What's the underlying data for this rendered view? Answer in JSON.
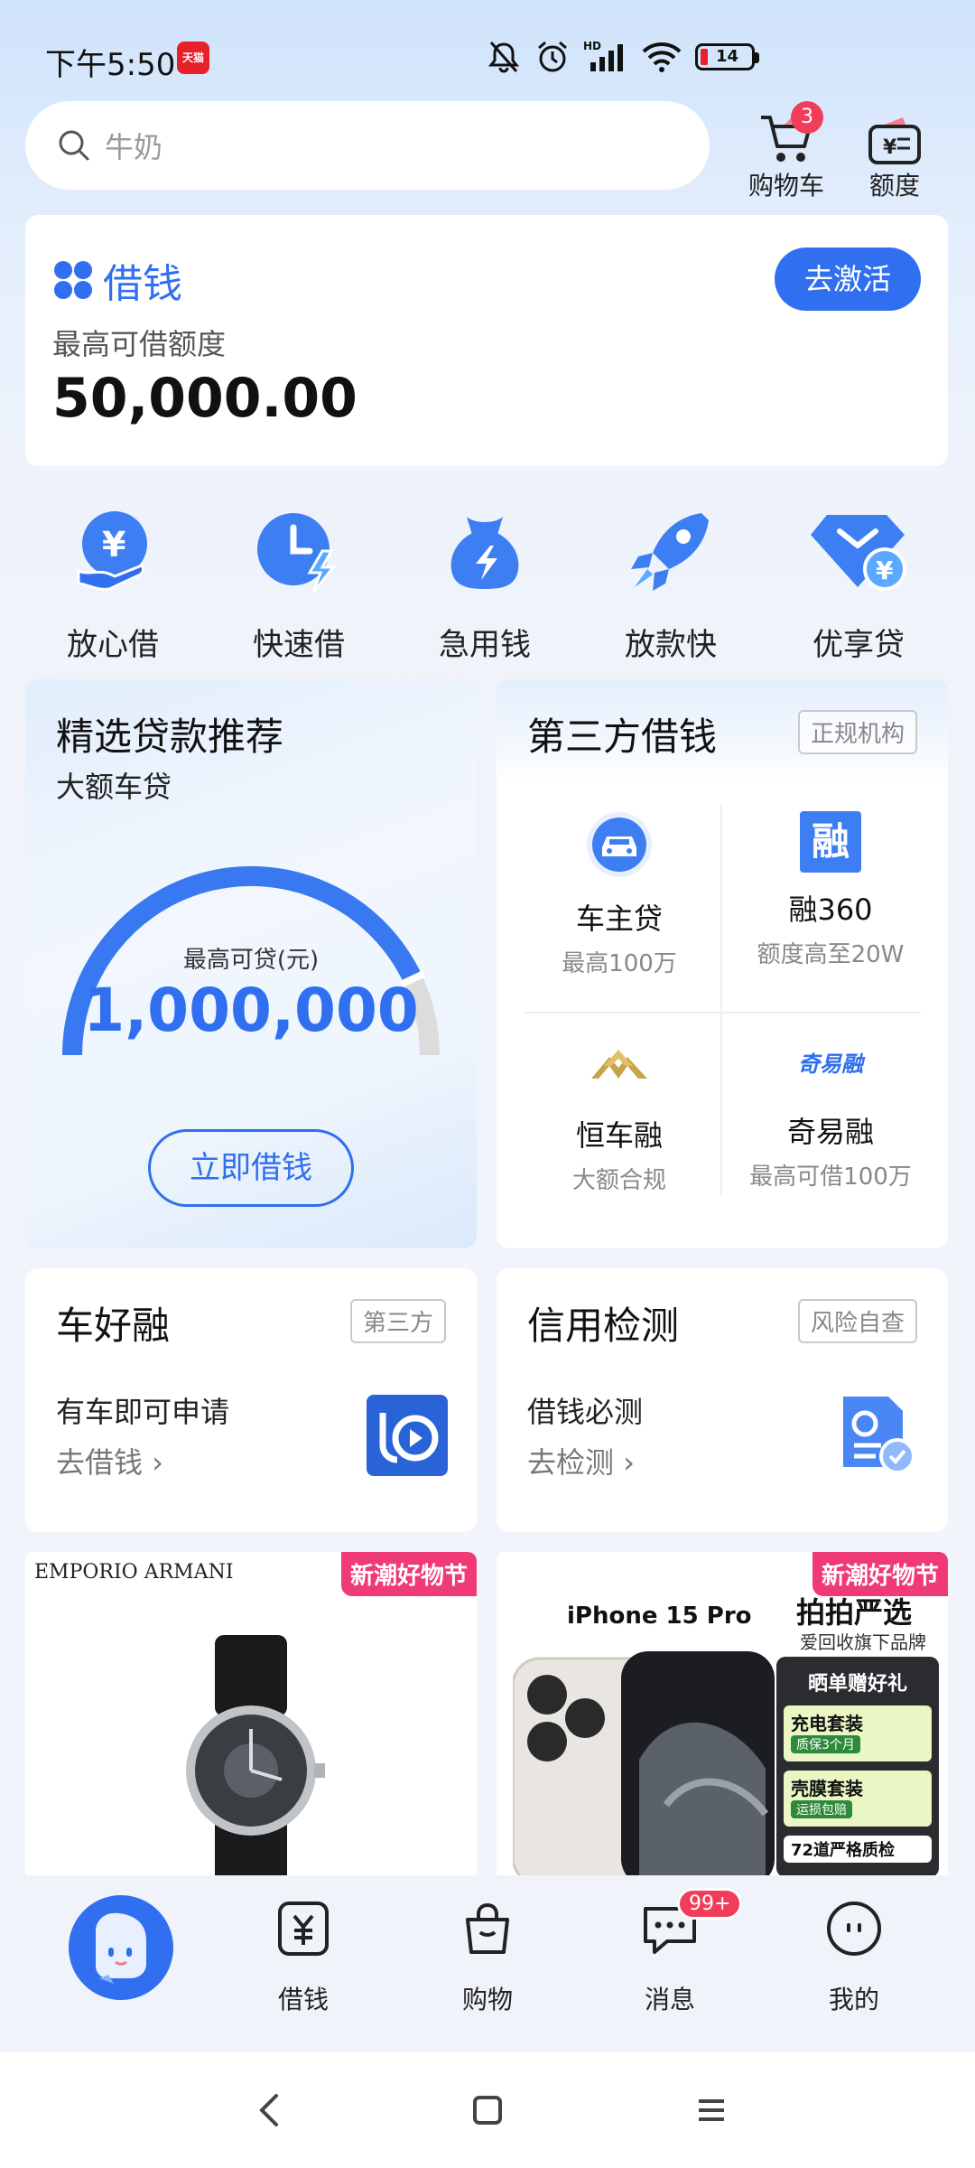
{
  "status_bar": {
    "time": "下午5:50",
    "app_badge": "天猫",
    "battery": "14"
  },
  "search": {
    "placeholder": "牛奶"
  },
  "top_actions": {
    "cart_label": "购物车",
    "cart_count": "3",
    "quota_label": "额度"
  },
  "loan_card": {
    "title": "借钱",
    "subtitle": "最高可借额度",
    "amount": "50,000.00",
    "button": "去激活"
  },
  "quick_actions": [
    {
      "label": "放心借",
      "icon": "yuan-hand-icon"
    },
    {
      "label": "快速借",
      "icon": "clock-bolt-icon"
    },
    {
      "label": "急用钱",
      "icon": "money-bag-icon"
    },
    {
      "label": "放款快",
      "icon": "rocket-icon"
    },
    {
      "label": "优享贷",
      "icon": "diamond-yuan-icon"
    }
  ],
  "featured_loan": {
    "title": "精选贷款推荐",
    "subtitle": "大额车贷",
    "gauge_label": "最高可贷(元)",
    "gauge_value": "1,000,000",
    "gauge_fill_fraction": 0.86,
    "button": "立即借钱"
  },
  "third_party": {
    "title": "第三方借钱",
    "tag": "正规机构",
    "items": [
      {
        "name": "车主贷",
        "desc": "最高100万",
        "icon": "car-icon"
      },
      {
        "name": "融360",
        "desc": "额度高至20W",
        "icon": "rong-logo-icon",
        "logo_text": "融"
      },
      {
        "name": "恒车融",
        "desc": "大额合规",
        "icon": "hengche-logo-icon"
      },
      {
        "name": "奇易融",
        "desc": "最高可借100万",
        "icon": "qiyirong-logo-icon",
        "logo_text": "奇易融"
      }
    ]
  },
  "che_hao_rong": {
    "title": "车好融",
    "tag": "第三方",
    "line1": "有车即可申请",
    "link": "去借钱"
  },
  "credit_check": {
    "title": "信用检测",
    "tag": "风险自查",
    "line1": "借钱必测",
    "link": "去检测"
  },
  "products": [
    {
      "brand": "EMPORIO ARMANI",
      "badge": "新潮好物节"
    },
    {
      "badge": "新潮好物节",
      "model": "iPhone 15 Pro",
      "promo_title": "拍拍严选",
      "promo_sub": "爱回收旗下品牌",
      "gift_title": "晒单赠好礼",
      "gift1": "充电套装",
      "gift1_sub": "质保3个月",
      "gift2": "壳膜套装",
      "gift2_sub": "运损包赔",
      "gift3": "72道严格质检"
    }
  ],
  "bottom_nav": {
    "items": [
      {
        "label": "借钱"
      },
      {
        "label": "购物"
      },
      {
        "label": "消息",
        "badge": "99+"
      },
      {
        "label": "我的"
      }
    ]
  },
  "colors": {
    "accent": "#2f6ff0",
    "badge": "#f23d5a",
    "promo": "#ef3a76"
  }
}
